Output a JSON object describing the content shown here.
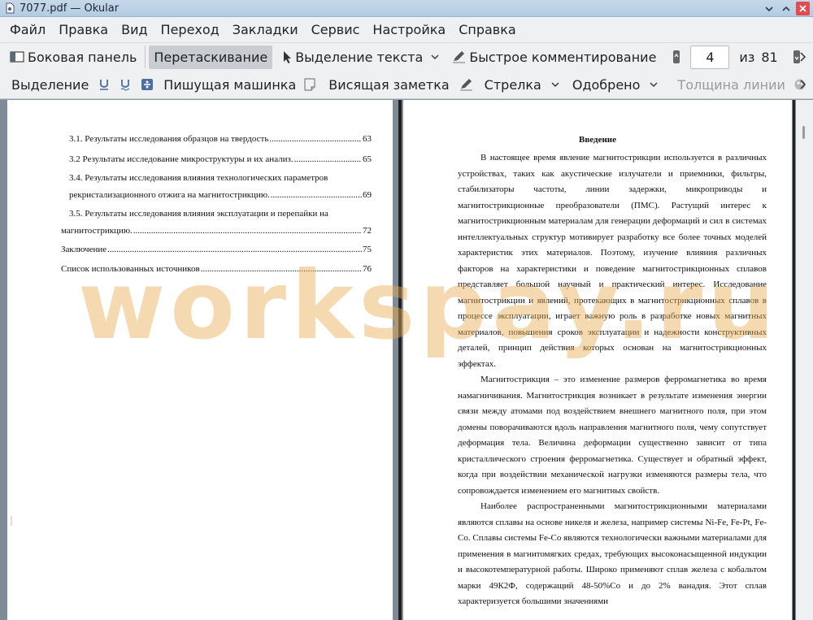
{
  "window": {
    "title": "7077.pdf  — Okular"
  },
  "menubar": {
    "items": [
      "Файл",
      "Правка",
      "Вид",
      "Переход",
      "Закладки",
      "Сервис",
      "Настройка",
      "Справка"
    ]
  },
  "toolbar1": {
    "sidebar_label": "Боковая панель",
    "drag_label": "Перетаскивание",
    "text_select_label": "Выделение текста",
    "quick_comment_label": "Быстрое комментирование",
    "page_current": "4",
    "page_of_label": "из",
    "page_total": "81"
  },
  "toolbar2": {
    "selection_label": "Выделение",
    "typewriter_label": "Пишущая машинка",
    "note_label": "Висящая заметка",
    "arrow_label": "Стрелка",
    "approved_label": "Одобрено",
    "line_width_label": "Толщина линии"
  },
  "watermark": "workspay.ru",
  "left_page": {
    "toc": [
      {
        "text": "3.1. Результаты исследования образцов на твердость",
        "page": "63"
      },
      {
        "text": "3.2 Результаты исследование микроструктуры и их анализ.",
        "page": "65"
      },
      {
        "text_line1": "3.4. Результаты исследования влияния технологических параметров",
        "text": "рекристализационного отжига на магнитострикцию.",
        "page": "69"
      },
      {
        "text_line1": "3.5. Результаты исследования влияния эксплуатации и перепайки на",
        "text": "магнитострикцию.",
        "page": "72"
      },
      {
        "text": "Заключение",
        "page": "75"
      },
      {
        "text": "Список использованных источников",
        "page": "76"
      }
    ]
  },
  "right_page": {
    "heading": "Введение",
    "paragraphs": [
      "В настоящее время явление магнитострикции используется в различных устройствах, таких как акустические излучатели и приемники, фильтры, стабилизаторы частоты, линии задержки, микроприводы и магнитострикционные преобразователи (ПМС). Растущий интерес к магнитострикционным материалам для генерации деформаций и сил в системах интеллектуальных структур мотивирует разработку все более точных моделей характеристик этих материалов. Поэтому, изучение влияния различных факторов на характеристики и поведение магнитострикционных сплавов представляет большой научный и практический интерес. Исследование магнитострикции и явлений, протекающих в магнитострикционных сплавов в процессе эксплуатации, играет важную роль в разработке новых магнитных материалов, повышения сроков эксплуатации и надежности конструктивных деталей, принцип действия которых основан на магнитострикционных эффектах.",
      "Магнитострикция – это изменение размеров ферромагнетика во время намагничивания. Магнитострикция возникает в результате изменения энергии связи между атомами под воздействием внешнего магнитного поля, при этом домены поворачиваются вдоль направления магнитного поля, чему сопутствует деформация тела. Величина деформации существенно зависит от типа кристаллического строения ферромагнетика. Существует и обратный эффект, когда при воздействии механической нагрузки изменяются размеры тела, что сопровождается изменением его магнитных свойств.",
      "Наиболее распространенными магнитострикционными материалами являются сплавы на основе никеля и железа, например системы Ni-Fe, Fe-Pt, Fe-Co. Сплавы системы Fe-Co являются технологически важными материалами для применения в магнитомягких средах, требующих высоконасыщенной индукции и высокотемпературной работы. Широко применяют сплав железа с кобальтом марки 49К2Ф, содержащий 48-50%Co и до 2% ванадия. Этот сплав характеризуется большими значениями"
    ]
  }
}
